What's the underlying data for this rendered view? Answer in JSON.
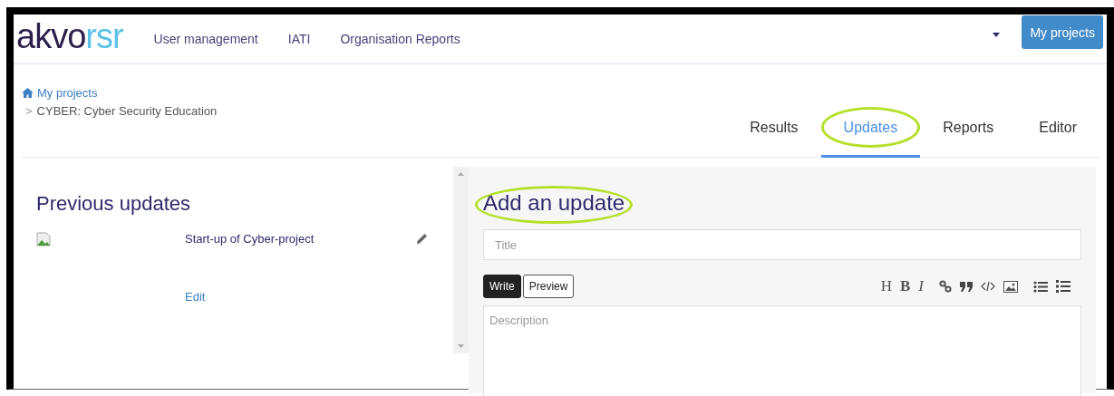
{
  "logo": {
    "part_1": "akvo",
    "part_2": "rsr"
  },
  "nav": [
    {
      "label": "User management"
    },
    {
      "label": "IATI"
    },
    {
      "label": "Organisation Reports"
    }
  ],
  "account_button": "My projects",
  "breadcrumb": {
    "home": "My projects",
    "separator": ">",
    "current": "CYBER: Cyber Security Education"
  },
  "tabs": [
    {
      "label": "Results",
      "selected": false,
      "highlighted": false
    },
    {
      "label": "Updates",
      "selected": true,
      "highlighted": true
    },
    {
      "label": "Reports",
      "selected": false,
      "highlighted": false
    },
    {
      "label": "Editor",
      "selected": false,
      "highlighted": false
    }
  ],
  "previous_updates": {
    "heading": "Previous updates",
    "items": [
      {
        "title": "Start-up of Cyber-project",
        "action": "Edit"
      }
    ]
  },
  "add_update": {
    "heading": "Add an update",
    "heading_highlighted": true,
    "title_placeholder": "Title",
    "modes": [
      {
        "label": "Write",
        "selected": true
      },
      {
        "label": "Preview",
        "selected": false
      }
    ],
    "format_tools": [
      {
        "kind": "heading",
        "label": "H"
      },
      {
        "kind": "bold",
        "label": "B"
      },
      {
        "kind": "italic",
        "label": "I"
      },
      {
        "kind": "link"
      },
      {
        "kind": "quote"
      },
      {
        "kind": "code"
      },
      {
        "kind": "image"
      },
      {
        "kind": "bullets"
      },
      {
        "kind": "numbers"
      }
    ],
    "description_placeholder": "Description"
  }
}
